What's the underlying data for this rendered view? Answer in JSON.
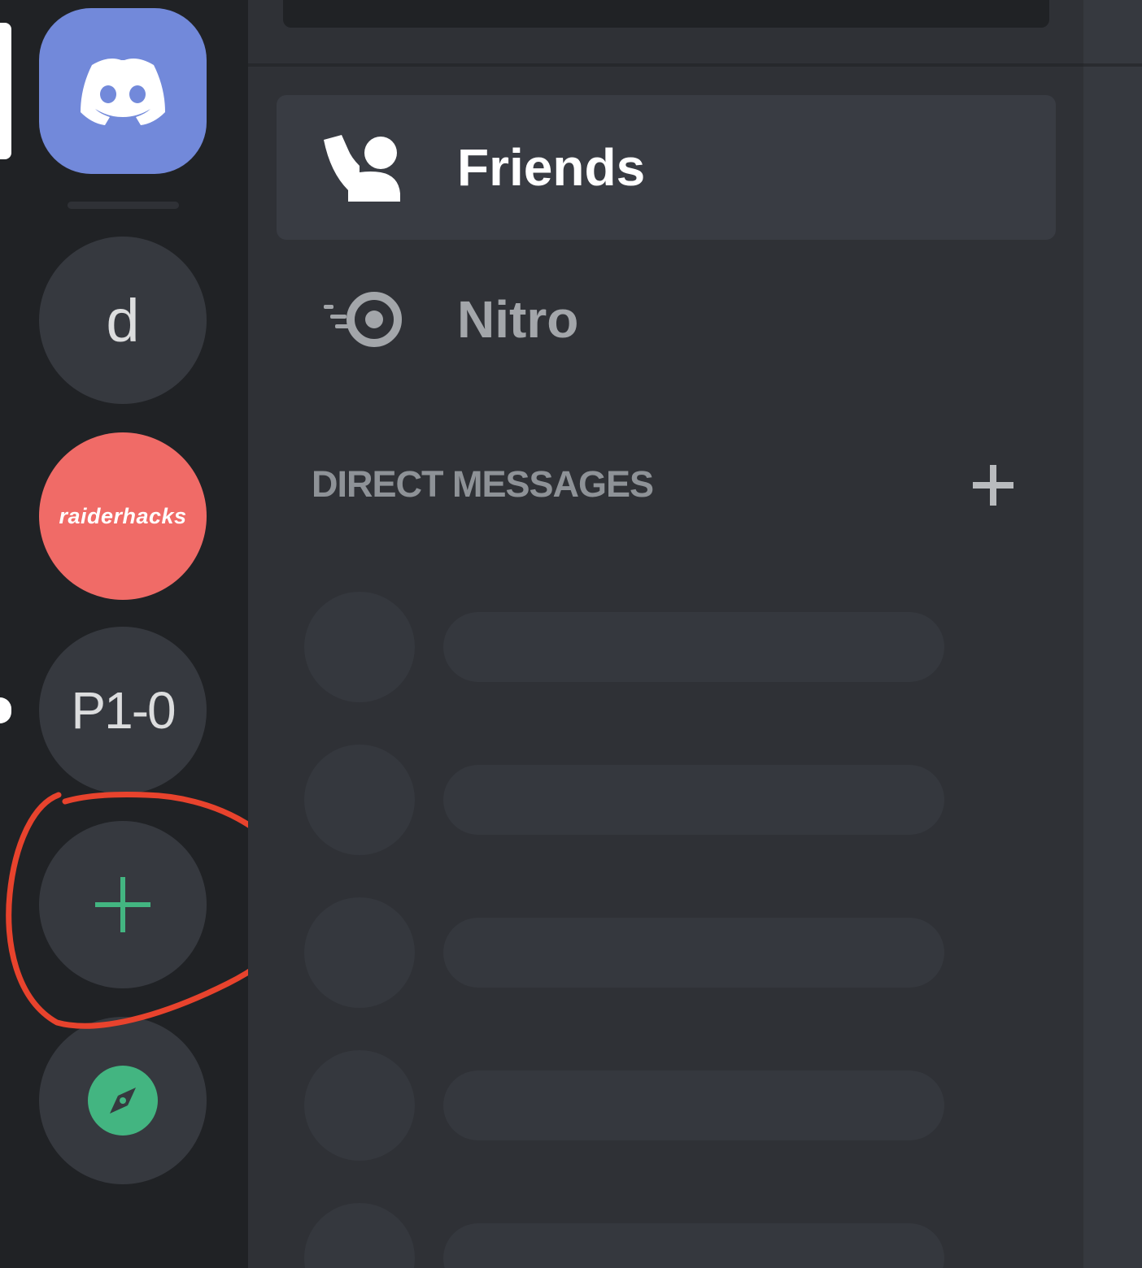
{
  "rail": {
    "servers": [
      {
        "initials": "d"
      },
      {
        "name": "raiderhacks"
      },
      {
        "initials": "P1-0"
      }
    ],
    "add_server": {
      "icon": "plus-icon",
      "color": "#43b581"
    },
    "explore": {
      "icon": "compass-icon",
      "color": "#43b581"
    },
    "home_icon": "discord-logo-icon",
    "colors": {
      "home": "#7289da",
      "raiderhacks": "#f06b67",
      "annotation": "#e8432d"
    }
  },
  "sidebar": {
    "nav": [
      {
        "label": "Friends",
        "icon": "friends-wave-icon",
        "selected": true
      },
      {
        "label": "Nitro",
        "icon": "nitro-icon",
        "selected": false
      }
    ],
    "dm_header": "DIRECT MESSAGES",
    "dm_add_icon": "plus-icon"
  }
}
